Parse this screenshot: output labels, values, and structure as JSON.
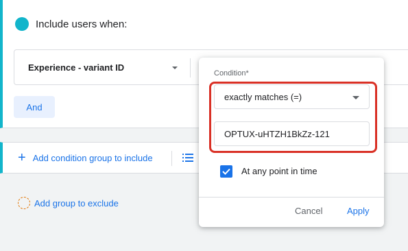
{
  "include_section": {
    "title": "Include users when:",
    "dimension": "Experience - variant ID",
    "and_button": "And"
  },
  "actions": {
    "add_condition_group_include": "Add condition group to include"
  },
  "exclude": {
    "add_group_to_exclude": "Add group to exclude"
  },
  "condition_popup": {
    "label": "Condition*",
    "operator": "exactly matches (=)",
    "value": "OPTUX-uHTZH1BkZz-121",
    "at_any_point_label": "At any point in time",
    "at_any_point_checked": true,
    "cancel": "Cancel",
    "apply": "Apply"
  },
  "colors": {
    "accent": "#12b5cb",
    "primary": "#1a73e8",
    "highlight": "#d93025",
    "exclude_circle": "#e37400"
  }
}
